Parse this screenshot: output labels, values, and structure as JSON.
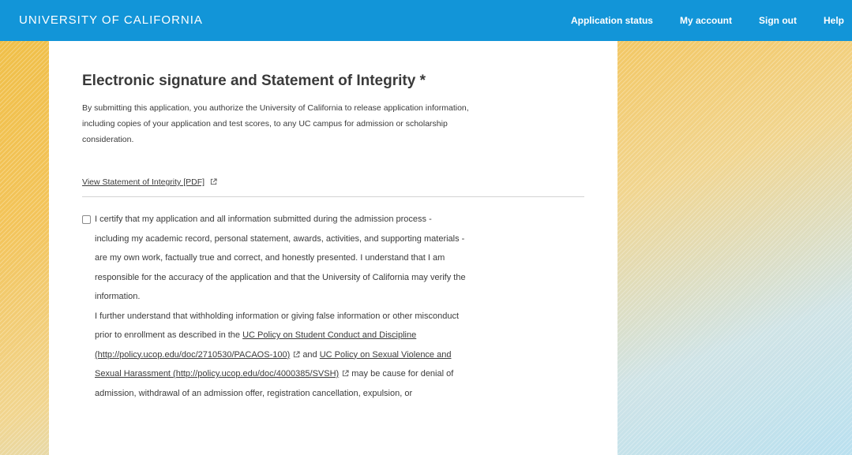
{
  "header": {
    "brand": "UNIVERSITY OF CALIFORNIA",
    "nav": {
      "application_status": "Application status",
      "my_account": "My account",
      "sign_out": "Sign out",
      "help": "Help"
    }
  },
  "section": {
    "title": "Electronic signature and Statement of Integrity *",
    "intro": "By submitting this application, you authorize the University of California to release application information, including copies of your application and test scores, to any UC campus for admission or scholarship consideration.",
    "statement_link": "View Statement of Integrity [PDF]"
  },
  "certification": {
    "checked": false,
    "paragraph1": "I certify that my application and all information submitted during the admission process - including my academic record, personal statement, awards, activities, and supporting materials - are my own work, factually true and correct, and honestly presented. I understand that I am responsible for the accuracy of the application and that the University of California may verify the information.",
    "paragraph2_start": "I further understand that withholding information or giving false information or other misconduct prior to enrollment as described in the",
    "policy1_link": "UC Policy on Student Conduct and Discipline (http://policy.ucop.edu/doc/2710530/PACAOS-100)",
    "and_text": "and",
    "policy2_link": "UC Policy on Sexual Violence and Sexual Harassment (http://policy.ucop.edu/doc/4000385/SVSH)",
    "paragraph2_end": "may be cause for denial of admission, withdrawal of an admission offer, registration cancellation, expulsion, or"
  },
  "icons": {
    "external_link": "external-link-icon"
  },
  "colors": {
    "header_blue": "#1295d8",
    "panel_bg": "#ffffff",
    "text": "#3b3b3b"
  }
}
